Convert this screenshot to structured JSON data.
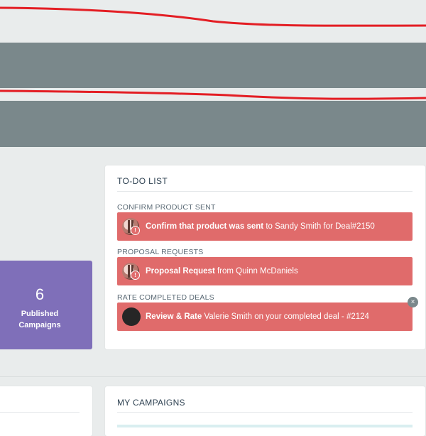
{
  "colors": {
    "background": "#e9ecec",
    "band": "#7a888b",
    "wave_line": "#e31e24",
    "todo_item": "#e06b6b",
    "stat_card": "#7f6fb9"
  },
  "todo": {
    "title": "TO-DO LIST",
    "sections": [
      {
        "label": "CONFIRM PRODUCT SENT",
        "item": {
          "bold": "Confirm that product was sent",
          "rest": " to Sandy Smith for Deal#2150"
        }
      },
      {
        "label": "PROPOSAL REQUESTS",
        "item": {
          "bold": "Proposal Request",
          "rest": " from Quinn McDaniels"
        }
      },
      {
        "label": "RATE COMPLETED DEALS",
        "item": {
          "bold": "Review & Rate",
          "rest": " Valerie Smith on your completed deal - #2124"
        }
      }
    ],
    "alert_badge": "!",
    "close_glyph": "×"
  },
  "stat": {
    "number": "6",
    "label_line1": "Published",
    "label_line2": "Campaigns"
  },
  "campaigns": {
    "title": "MY CAMPAIGNS"
  }
}
